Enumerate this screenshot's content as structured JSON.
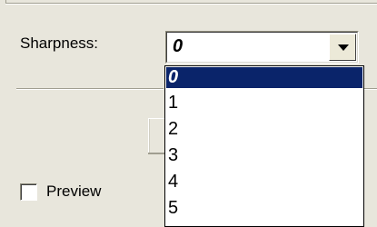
{
  "settings": {
    "sharpness_label": "Sharpness:",
    "sharpness_value": "0",
    "preview_label": "Preview",
    "preview_checked": false
  },
  "dropdown": {
    "options": [
      "0",
      "1",
      "2",
      "3",
      "4",
      "5"
    ],
    "selected_index": 0
  },
  "colors": {
    "panel_bg": "#e8e6dc",
    "selection_bg": "#0a246a",
    "selection_fg": "#ffffff"
  }
}
